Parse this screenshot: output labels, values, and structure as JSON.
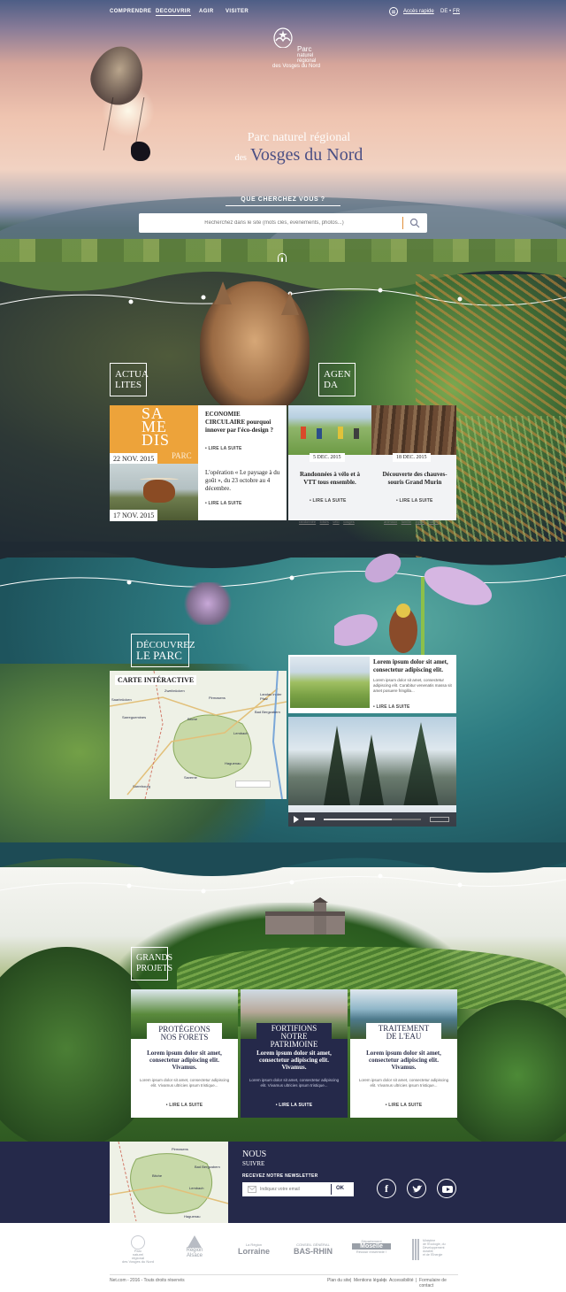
{
  "nav": {
    "items": [
      "COMPRENDRE",
      "DECOUVRIR",
      "AGIR",
      "VISITER"
    ],
    "quick_access": "Accès rapide",
    "lang_de": "DE",
    "lang_fr": "FR"
  },
  "logo": {
    "line1": "Parc",
    "line2": "naturel",
    "line3": "régional",
    "line4": "des Vosges du Nord"
  },
  "hero": {
    "title_line1": "Parc naturel régional",
    "title_des": "des",
    "title_line2": "Vosges du Nord",
    "search_label": "QUE CHERCHEZ VOUS ?",
    "search_placeholder": "Recherchez dans le site (mots clés, évènements, photos...)"
  },
  "actualites": {
    "label_line1": "ACTUA",
    "label_line2": "LITES",
    "items": [
      {
        "date": "22 NOV. 2015",
        "title": "ECONOMIE CIRCULAIRE pourquoi innover par l'éco-design ?",
        "link": "• LIRE LA SUITE",
        "img_text_1": "SA",
        "img_text_2": "ME",
        "img_text_3": "DIS",
        "img_text_4": "PARC"
      },
      {
        "date": "17 NOV. 2015",
        "title": "L'opération « Le paysage à du goût », du 23 octobre au 4 décembre.",
        "link": "• LIRE LA SUITE"
      }
    ]
  },
  "agenda": {
    "label_line1": "AGEN",
    "label_line2": "DA",
    "items": [
      {
        "date": "5 DEC. 2015",
        "title": "Randonnées à vélo et à VTT tous ensemble.",
        "link": "• LIRE LA SUITE",
        "tags": [
          "randonnée",
          "loisirs",
          "vélo",
          "vosges"
        ]
      },
      {
        "date": "18 DEC. 2015",
        "title": "Découverte des chauves-souris Grand Murin",
        "link": "• LIRE LA SUITE",
        "tags": [
          "animaux",
          "famille",
          "église",
          "nature"
        ]
      }
    ]
  },
  "decouvrez": {
    "label_line1": "DÉCOUVREZ",
    "label_line2": "LE PARC",
    "map_title": "CARTE INTÉRACTIVE",
    "map_places": [
      "Saarbrücken",
      "Zweibrücken",
      "Pirmasens",
      "Landau in der Pfalz",
      "Sarreguemines",
      "Bitche",
      "Haguenau",
      "Saverne",
      "Sarrebourg",
      "Lembach",
      "Bad Bergzabern"
    ],
    "article_title": "Lorem ipsum dolor sit amet, consectetur adipiscing elit.",
    "article_body": "Lorem ipsum dolor sit amet, consectetur adipiscing elit. Curabitur venenatis massa sit amet posuere fringilla...",
    "article_link": "• LIRE LA SUITE"
  },
  "projets": {
    "label_line1": "GRANDS",
    "label_line2": "PROJETS",
    "items": [
      {
        "title_line1": "PROTÉGEONS",
        "title_line2": "NOS FORETS",
        "head": "Lorem ipsum dolor sit amet, consectetur adipiscing elit. Vivamus.",
        "body": "Lorem ipsum dolor sit amet, consectetur adipiscing elit. Vivamus ultricies ipsum tristique...",
        "link": "• LIRE LA SUITE"
      },
      {
        "title_line1": "FORTIFIONS",
        "title_line2": "NOTRE PATRIMOINE",
        "head": "Lorem ipsum dolor sit amet, consectetur adipiscing elit. Vivamus.",
        "body": "Lorem ipsum dolor sit amet, consectetur adipiscing elit. Vivamus ultricies ipsum tristique...",
        "link": "• LIRE LA SUITE"
      },
      {
        "title_line1": "TRAITEMENT",
        "title_line2": "DE L'EAU",
        "head": "Lorem ipsum dolor sit amet, consectetur adipiscing elit. Vivamus.",
        "body": "Lorem ipsum dolor sit amet, consectetur adipiscing elit. Vivamus ultricies ipsum tristique...",
        "link": "• LIRE LA SUITE"
      }
    ]
  },
  "footer": {
    "follow_line1": "NOUS",
    "follow_line2": "SUIVRE",
    "newsletter_label": "RECEVEZ NOTRE NEWSLETTER",
    "email_placeholder": "Indiquez votre email",
    "ok": "OK",
    "map_places": [
      "Pirmasens",
      "Bad Bergzabern",
      "Bitche",
      "Lembach",
      "Haguenau"
    ],
    "partners": [
      {
        "l1": "Parc",
        "l2": "naturel",
        "l3": "régional",
        "l4": "des Vosges du Nord"
      },
      {
        "l1": "Région",
        "l2": "Alsace"
      },
      {
        "l1": "La Région",
        "l2": "Lorraine"
      },
      {
        "l1": "CONSEIL GÉNÉRAL",
        "l2": "BAS-RHIN"
      },
      {
        "l1": "Département",
        "l2": "Moselle",
        "l3": "Réussir ensemble !"
      },
      {
        "l1": "Ministère",
        "l2": "de l'Écologie, du Développement",
        "l3": "durable",
        "l4": "et de l'Énergie"
      }
    ],
    "copyright": "Net.com - 2016 - Touts droits réservés",
    "links": [
      "Plan du site",
      "Mentions légales",
      "Accessibilité",
      "Formulaire de contact"
    ]
  },
  "colors": {
    "navy": "#25294a",
    "orange": "#eda33a",
    "white": "#ffffff"
  }
}
